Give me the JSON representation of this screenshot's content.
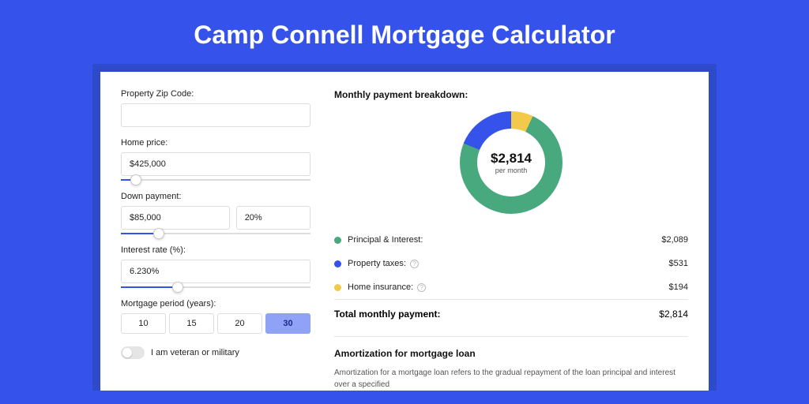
{
  "title": "Camp Connell Mortgage Calculator",
  "form": {
    "zip_label": "Property Zip Code:",
    "zip_value": "",
    "home_price_label": "Home price:",
    "home_price_value": "$425,000",
    "down_payment_label": "Down payment:",
    "down_payment_value": "$85,000",
    "down_payment_pct": "20%",
    "interest_label": "Interest rate (%):",
    "interest_value": "6.230%",
    "period_label": "Mortgage period (years):",
    "periods": [
      "10",
      "15",
      "20",
      "30"
    ],
    "period_selected": "30",
    "veteran_label": "I am veteran or military"
  },
  "sliders": {
    "home_price_fill_pct": 8,
    "down_payment_fill_pct": 20,
    "interest_fill_pct": 30
  },
  "breakdown": {
    "title": "Monthly payment breakdown:",
    "donut_amount": "$2,814",
    "donut_sub": "per month",
    "items": [
      {
        "label": "Principal & Interest:",
        "value": "$2,089",
        "color": "green",
        "info": false
      },
      {
        "label": "Property taxes:",
        "value": "$531",
        "color": "blue",
        "info": true
      },
      {
        "label": "Home insurance:",
        "value": "$194",
        "color": "yellow",
        "info": true
      }
    ],
    "total_label": "Total monthly payment:",
    "total_value": "$2,814"
  },
  "amortization": {
    "title": "Amortization for mortgage loan",
    "body": "Amortization for a mortgage loan refers to the gradual repayment of the loan principal and interest over a specified"
  },
  "chart_data": {
    "type": "pie",
    "title": "Monthly payment breakdown",
    "series": [
      {
        "name": "Principal & Interest",
        "value": 2089,
        "color": "#49a97e"
      },
      {
        "name": "Property taxes",
        "value": 531,
        "color": "#3553eb"
      },
      {
        "name": "Home insurance",
        "value": 194,
        "color": "#f3c94b"
      }
    ],
    "total": 2814,
    "unit": "USD per month"
  }
}
